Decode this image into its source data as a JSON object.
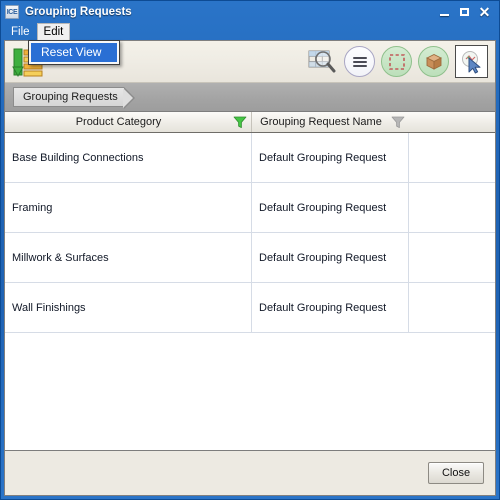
{
  "window": {
    "title": "Grouping Requests",
    "app_icon_label": "ICE",
    "controls": {
      "minimize": "minimize-icon",
      "maximize": "maximize-icon",
      "close": "close-icon"
    }
  },
  "menubar": {
    "items": [
      {
        "label": "File",
        "open": false
      },
      {
        "label": "Edit",
        "open": true
      }
    ]
  },
  "dropdown": {
    "owner": "Edit",
    "items": [
      {
        "label": "Reset View",
        "highlighted": true
      }
    ]
  },
  "toolbar": {
    "left_icon": "grouping-sort-icon",
    "buttons": [
      {
        "name": "zoom-to-grid-icon",
        "style": "flat"
      },
      {
        "name": "list-menu-icon",
        "style": "circle-plain"
      },
      {
        "name": "marquee-select-icon",
        "style": "circle-green"
      },
      {
        "name": "box-volume-icon",
        "style": "circle-green"
      },
      {
        "name": "pointer-select-icon",
        "style": "pressed"
      }
    ]
  },
  "breadcrumb": {
    "items": [
      {
        "label": "Grouping Requests"
      }
    ]
  },
  "grid": {
    "columns": [
      {
        "label": "Product Category",
        "filter_icon": "funnel-icon",
        "filter_active": true
      },
      {
        "label": "Grouping Request Name",
        "filter_icon": "funnel-icon",
        "filter_active": false
      }
    ],
    "rows": [
      {
        "product_category": "Base Building Connections",
        "grouping_request_name": "Default Grouping Request"
      },
      {
        "product_category": "Framing",
        "grouping_request_name": "Default Grouping Request"
      },
      {
        "product_category": "Millwork & Surfaces",
        "grouping_request_name": "Default Grouping Request"
      },
      {
        "product_category": "Wall Finishings",
        "grouping_request_name": "Default Grouping Request"
      }
    ]
  },
  "footer": {
    "close_label": "Close"
  },
  "colors": {
    "titlebar_blue": "#1f63b4",
    "menu_highlight": "#2a6fd4",
    "toolbar_bg": "#efece4",
    "breadcrumb_bg": "#a4a4a4",
    "filter_active_green": "#3fbf3f",
    "filter_inactive_gray": "#b6b6b6",
    "green_button": "#c6e4c4",
    "row_border": "#d6dce6"
  }
}
